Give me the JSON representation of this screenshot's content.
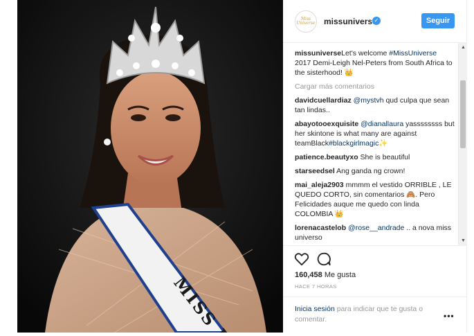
{
  "post": {
    "username": "missuniverse",
    "avatar_text": "Miss Universe",
    "follow_label": "Seguir",
    "caption": {
      "user": "missuniverse",
      "text_before": "Let's welcome ",
      "hashtag": "#MissUniverse",
      "text_after": " 2017 Demi-Leigh Nel-Peters from South Africa to the sisterhood! 👑"
    },
    "load_more": "Cargar más comentarios",
    "comments": [
      {
        "user": "davidcuellardiaz",
        "pre": " ",
        "mention": "@mystvh",
        "text": " qud culpa que sean tan lindas..",
        "tag": "",
        "tail": ""
      },
      {
        "user": "abayotooexquisite",
        "pre": " ",
        "mention": "@dianallaura",
        "text": " yassssssss but her skintone is what many are against teamBlack",
        "tag": "#blackgirlmagic",
        "tail": "✨"
      },
      {
        "user": "patience.beautyxo",
        "pre": " She is beautiful",
        "mention": "",
        "text": "",
        "tag": "",
        "tail": ""
      },
      {
        "user": "starseedsel",
        "pre": " Ang ganda ng crown!",
        "mention": "",
        "text": "",
        "tag": "",
        "tail": ""
      },
      {
        "user": "mai_aleja2903",
        "pre": " mmmm el vestido ORRIBLE , LE QUEDO CORTO, sin comentarios 🙈. Pero Felicidades auque me quedo con linda COLOMBIA 👑",
        "mention": "",
        "text": "",
        "tag": "",
        "tail": ""
      },
      {
        "user": "lorenacastelob",
        "pre": " ",
        "mention": "@rose__andrade",
        "text": " .. a nova miss universo",
        "tag": "",
        "tail": ""
      }
    ],
    "likes_count": "160,458",
    "likes_label": " Me gusta",
    "time_ago": "HACE 7 HORAS",
    "login_link": "Inicia sesión",
    "login_rest": " para indicar que te gusta o comentar.",
    "more_options": "•••",
    "sash_text": "MISS U",
    "colors": {
      "accent": "#3897f0",
      "link": "#003569",
      "muted": "#999999"
    }
  }
}
